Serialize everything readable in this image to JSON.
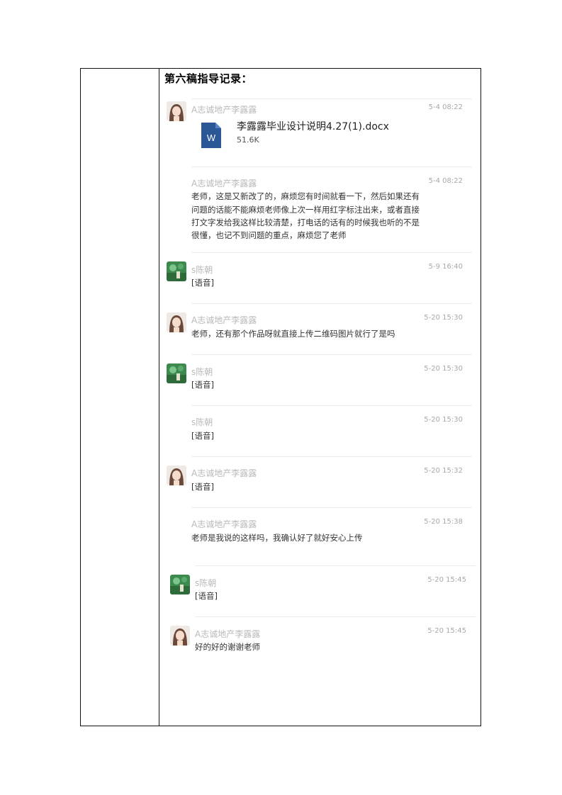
{
  "section_title": "第六稿指导记录：",
  "messages": [
    {
      "sender": "A志诚地产李露露",
      "time": "5-4 08:22",
      "avatar": "girl-avatar",
      "file": {
        "name": "李露露毕业设计说明4.27(1).docx",
        "size": "51.6K",
        "icon": "word-doc-icon",
        "icon_letter": "W"
      }
    },
    {
      "sender": "A志诚地产李露露",
      "time": "5-4 08:22",
      "lines": [
        "老师，这是又新改了的，麻烦您有时间就看一下，然后如果还有",
        "问题的话能不能麻烦老师像上次一样用红字标注出来，或者直接",
        "打文字发给我这样比较清楚，打电话的话有的时候我也听的不是",
        "很懂，也记不到问题的重点，麻烦您了老师"
      ]
    },
    {
      "sender": "s陈朝",
      "time": "5-9 16:40",
      "avatar": "landscape-avatar",
      "lines": [
        "[语音]"
      ]
    },
    {
      "sender": "A志诚地产李露露",
      "time": "5-20 15:30",
      "avatar": "girl-avatar",
      "lines": [
        "老师，还有那个作品呀就直接上传二维码图片就行了是吗"
      ]
    },
    {
      "sender": "s陈朝",
      "time": "5-20 15:30",
      "avatar": "landscape-avatar",
      "lines": [
        "[语音]"
      ]
    },
    {
      "sender": "s陈朝",
      "time": "5-20 15:30",
      "lines": [
        "[语音]"
      ]
    },
    {
      "sender": "A志诚地产李露露",
      "time": "5-20 15:32",
      "avatar": "girl-avatar",
      "lines": [
        "[语音]"
      ]
    },
    {
      "sender": "A志诚地产李露露",
      "time": "5-20 15:38",
      "lines": [
        "老师是我说的这样吗，我确认好了就好安心上传"
      ]
    },
    {
      "sender": "s陈朝",
      "time": "5-20 15:45",
      "avatar": "landscape-avatar",
      "lines": [
        "[语音]"
      ]
    },
    {
      "sender": "A志诚地产李露露",
      "time": "5-20 15:45",
      "avatar": "girl-avatar",
      "lines": [
        "好的好的谢谢老师"
      ]
    }
  ]
}
